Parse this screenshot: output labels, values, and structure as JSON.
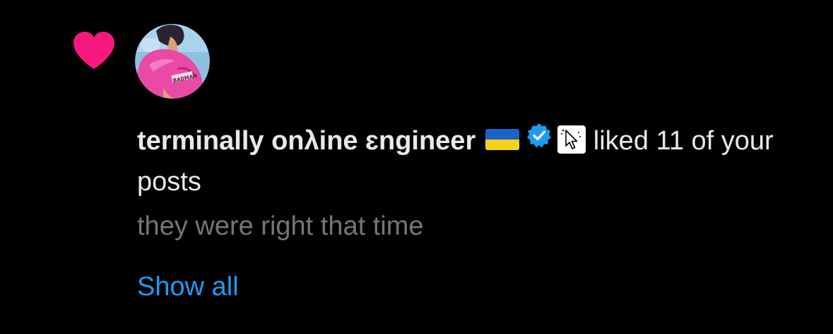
{
  "notification": {
    "type": "like",
    "user_name": "terminally onλine ɛngineer",
    "badges": [
      "ukraine-flag-icon",
      "verified-badge-icon",
      "cursor-icon"
    ],
    "action_text": "liked 11 of your posts",
    "post_preview": "they were right that time",
    "show_all_label": "Show all",
    "avatar_text": "BADMAN"
  },
  "colors": {
    "background": "#000000",
    "heart": "#f91880",
    "primary_text": "#e7e9ea",
    "secondary_text": "#71767b",
    "link": "#1d9bf0",
    "verified": "#1d9bf0"
  }
}
